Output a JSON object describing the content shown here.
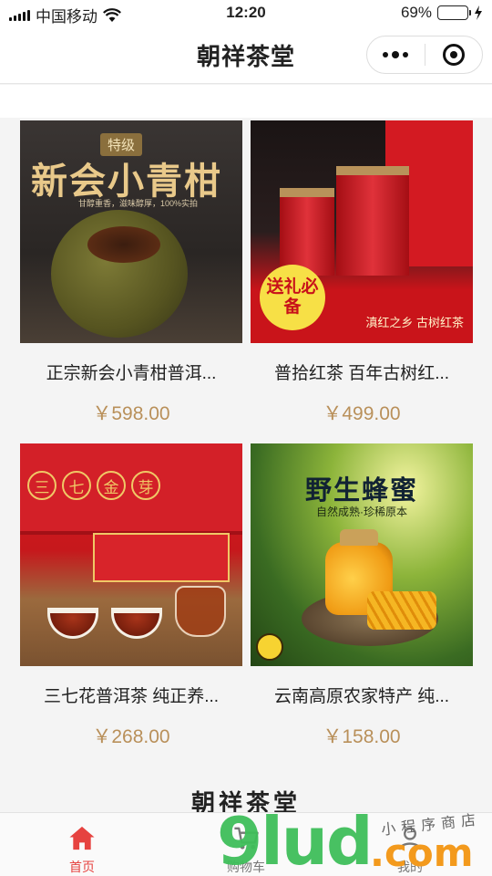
{
  "status_bar": {
    "carrier": "中国移动",
    "time": "12:20",
    "battery_percent": "69%",
    "battery_level": 0.69
  },
  "navbar": {
    "title": "朝祥茶堂"
  },
  "products": [
    {
      "name": "正宗新会小青柑普洱...",
      "price": "￥598.00",
      "image": {
        "tag": "特级",
        "headline": "新会小青柑",
        "caption": "甘醇重香，滋味醇厚，100%实拍"
      }
    },
    {
      "name": "普拾红茶 百年古树红...",
      "price": "￥499.00",
      "image": {
        "badge": "送礼必备",
        "slogan": "滇红之乡 古树红茶"
      }
    },
    {
      "name": "三七花普洱茶 纯正养...",
      "price": "￥268.00",
      "image": {
        "circles": [
          "三",
          "七",
          "金",
          "芽"
        ]
      }
    },
    {
      "name": "云南高原农家特产 纯...",
      "price": "￥158.00",
      "image": {
        "headline": "野生蜂蜜",
        "caption": "自然成熟·珍稀原本"
      }
    }
  ],
  "footer_logo": "朝祥茶堂",
  "tabbar": {
    "tabs": [
      {
        "label": "首页",
        "icon": "home-icon",
        "active": true
      },
      {
        "label": "购物车",
        "icon": "cart-icon",
        "active": false
      },
      {
        "label": "我的",
        "icon": "user-icon",
        "active": false
      }
    ],
    "active_color": "#e64340"
  },
  "watermark": {
    "brand": "9lud",
    "suffix": ".com",
    "tagline": "小程序商店"
  },
  "colors": {
    "price": "#b9905a",
    "background": "#f4f4f4"
  }
}
